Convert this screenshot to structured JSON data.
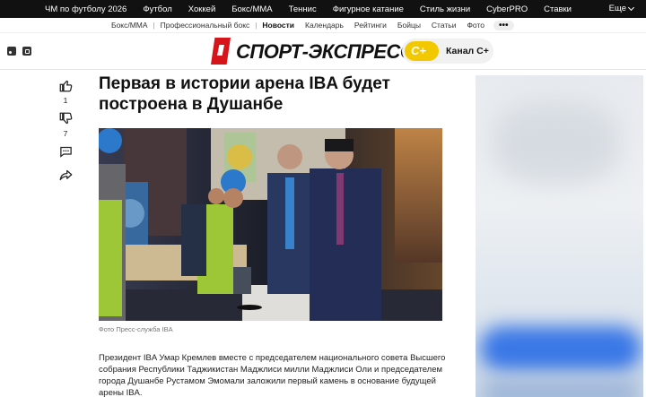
{
  "topnav": {
    "items": [
      "ЧМ по футболу 2026",
      "Футбол",
      "Хоккей",
      "Бокс/ММА",
      "Теннис",
      "Фигурное катание",
      "Стиль жизни",
      "CyberPRO",
      "Ставки"
    ],
    "more_label": "Еще"
  },
  "subnav": {
    "items": [
      "Бокс/ММА",
      "Профессиональный бокс",
      "Новости",
      "Календарь",
      "Рейтинги",
      "Бойцы",
      "Статьи",
      "Фото"
    ],
    "active": "Новости",
    "more_label": "•••"
  },
  "header": {
    "logo_text": "СПОРТ-ЭКСПРЕСС",
    "channel_label": "Канал С+",
    "brand_color": "#d7141a",
    "channel_color": "#f2c800"
  },
  "rail": {
    "likes": "1",
    "dislikes": "7",
    "icons": [
      "thumbs-up-icon",
      "thumbs-down-icon",
      "comment-icon",
      "share-icon"
    ]
  },
  "article": {
    "title": "Первая в истории арена IBA будет построена в Душанбе",
    "caption": "Фото Пресс-служба IBA",
    "body": "Президент IBA Умар Кремлев вместе с председателем национального совета Высшего собрания Республики Таджикистан Маджлиси милли Маджлиси Оли и председателем города Душанбе Рустамом Эмомали заложили первый камень в основание будущей арены IBA."
  }
}
